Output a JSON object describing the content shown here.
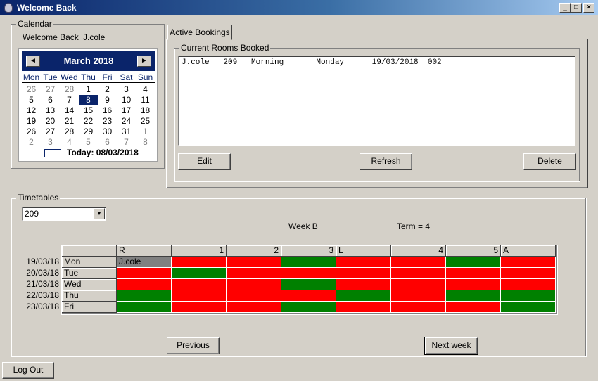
{
  "window": {
    "title": "Welcome Back",
    "buttons": [
      "_",
      "□",
      "×"
    ]
  },
  "calendar_group": {
    "legend": "Calendar",
    "welcome_text": "Welcome Back",
    "username": "J.cole",
    "month_title": "March 2018",
    "prev_icon": "◄",
    "next_icon": "►",
    "dow": [
      "Mon",
      "Tue",
      "Wed",
      "Thu",
      "Fri",
      "Sat",
      "Sun"
    ],
    "weeks": [
      [
        {
          "d": "26",
          "m": true
        },
        {
          "d": "27",
          "m": true
        },
        {
          "d": "28",
          "m": true
        },
        {
          "d": "1"
        },
        {
          "d": "2"
        },
        {
          "d": "3"
        },
        {
          "d": "4"
        }
      ],
      [
        {
          "d": "5"
        },
        {
          "d": "6"
        },
        {
          "d": "7"
        },
        {
          "d": "8",
          "s": true
        },
        {
          "d": "9"
        },
        {
          "d": "10"
        },
        {
          "d": "11"
        }
      ],
      [
        {
          "d": "12"
        },
        {
          "d": "13"
        },
        {
          "d": "14"
        },
        {
          "d": "15"
        },
        {
          "d": "16"
        },
        {
          "d": "17"
        },
        {
          "d": "18"
        }
      ],
      [
        {
          "d": "19"
        },
        {
          "d": "20"
        },
        {
          "d": "21"
        },
        {
          "d": "22"
        },
        {
          "d": "23"
        },
        {
          "d": "24"
        },
        {
          "d": "25"
        }
      ],
      [
        {
          "d": "26"
        },
        {
          "d": "27"
        },
        {
          "d": "28"
        },
        {
          "d": "29"
        },
        {
          "d": "30"
        },
        {
          "d": "31"
        },
        {
          "d": "1",
          "m": true
        }
      ],
      [
        {
          "d": "2",
          "m": true
        },
        {
          "d": "3",
          "m": true
        },
        {
          "d": "4",
          "m": true
        },
        {
          "d": "5",
          "m": true
        },
        {
          "d": "6",
          "m": true
        },
        {
          "d": "7",
          "m": true
        },
        {
          "d": "8",
          "m": true
        }
      ]
    ],
    "today_text": "Today: 08/03/2018"
  },
  "bookings": {
    "tab_label": "Active Bookings",
    "legend": "Current Rooms Booked",
    "rows": [
      "J.cole   209   Morning       Monday      19/03/2018  002"
    ],
    "edit_label": "Edit",
    "refresh_label": "Refresh",
    "delete_label": "Delete"
  },
  "timetables": {
    "legend": "Timetables",
    "room_value": "209",
    "week_text": "Week B",
    "term_text": "Term = 4",
    "columns": [
      {
        "label": "R",
        "align": "left"
      },
      {
        "label": "1",
        "align": "right"
      },
      {
        "label": "2",
        "align": "right"
      },
      {
        "label": "3",
        "align": "right",
        "extra": "L"
      },
      {
        "label": "4",
        "align": "right"
      },
      {
        "label": "5",
        "align": "right",
        "extra": "A"
      }
    ],
    "rows": [
      {
        "date": "19/03/18",
        "day": "Mon",
        "cells": [
          "grey:J.cole",
          "red",
          "red",
          "green",
          "red",
          "red",
          "green",
          "red"
        ]
      },
      {
        "date": "20/03/18",
        "day": "Tue",
        "cells": [
          "red",
          "green",
          "red",
          "red",
          "red",
          "red",
          "red",
          "red"
        ]
      },
      {
        "date": "21/03/18",
        "day": "Wed",
        "cells": [
          "red",
          "red",
          "red",
          "green",
          "red",
          "red",
          "red",
          "red"
        ]
      },
      {
        "date": "22/03/18",
        "day": "Thu",
        "cells": [
          "green",
          "red",
          "red",
          "red",
          "green",
          "red",
          "green",
          "green"
        ]
      },
      {
        "date": "23/03/18",
        "day": "Fri",
        "cells": [
          "green",
          "red",
          "red",
          "green",
          "red",
          "red",
          "red",
          "green"
        ]
      }
    ],
    "previous_label": "Previous",
    "next_week_label": "Next week"
  },
  "logout_label": "Log Out",
  "colors": {
    "booked": "#ff0000",
    "free": "#008000",
    "own": "#808080"
  }
}
